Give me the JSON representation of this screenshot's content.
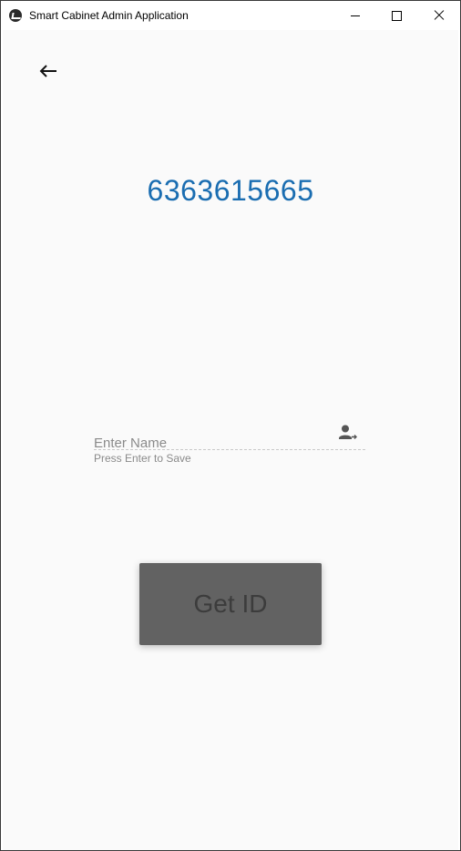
{
  "window": {
    "title": "Smart Cabinet Admin Application"
  },
  "icons": {
    "app": "kivy-app-icon",
    "minimize": "minimize-icon",
    "maximize": "maximize-icon",
    "close": "close-icon",
    "back": "arrow-left-icon",
    "person": "person-arrow-icon"
  },
  "main": {
    "phone_number": "6363615665",
    "name_field": {
      "placeholder": "Enter Name",
      "value": "",
      "helper": "Press Enter to Save"
    },
    "get_id_label": "Get ID"
  },
  "colors": {
    "accent": "#1a6db1",
    "button_bg": "#626262",
    "button_text": "#3c3c3c",
    "background": "#fafafa"
  }
}
